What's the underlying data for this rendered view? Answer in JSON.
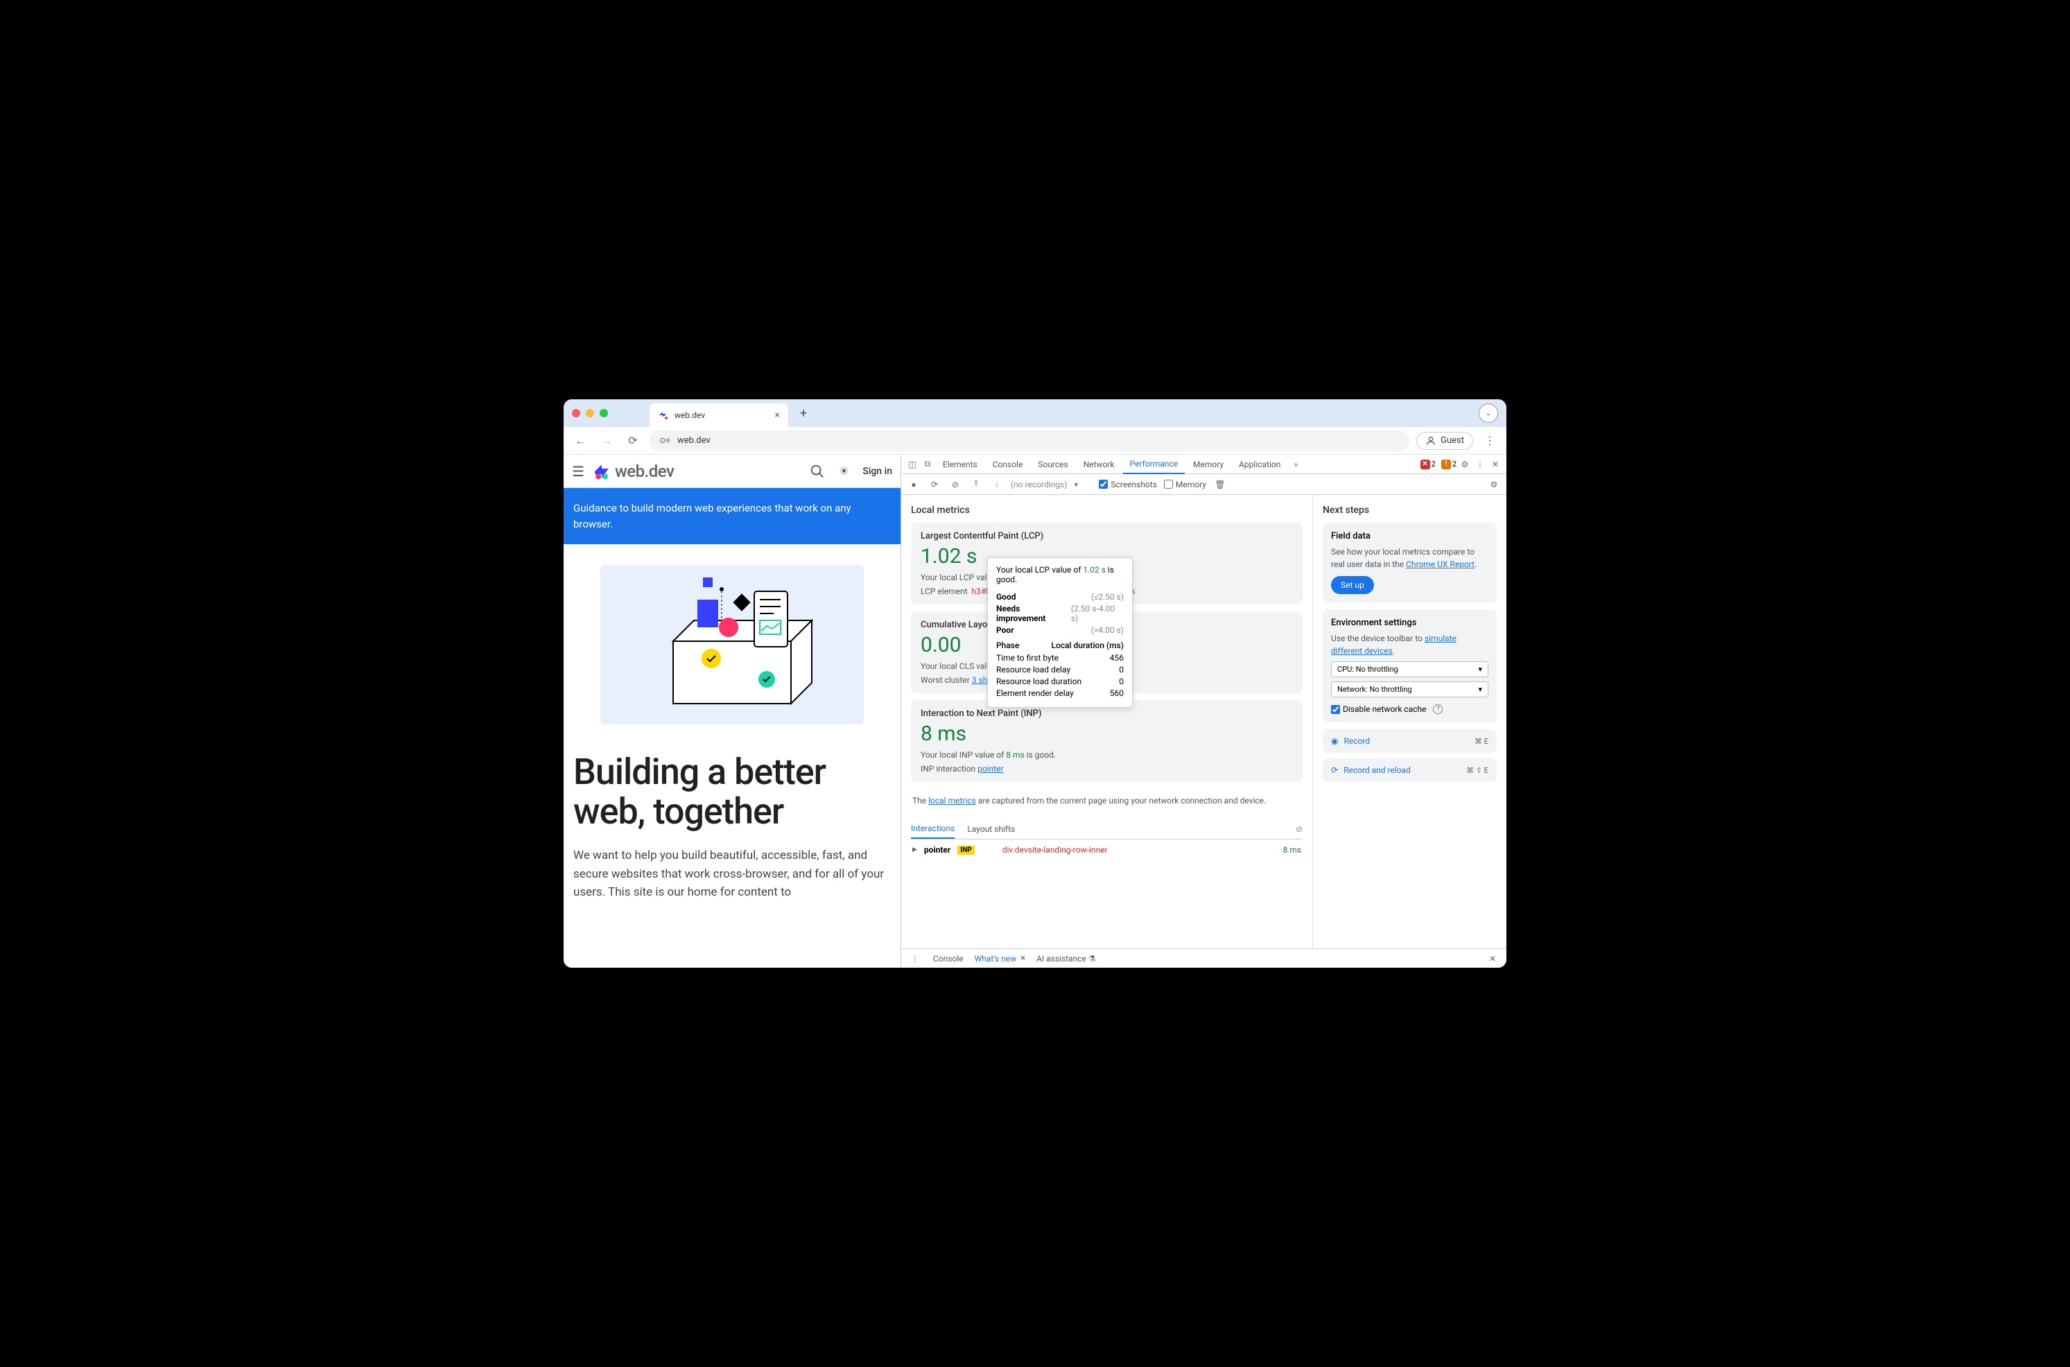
{
  "browser": {
    "tab_title": "web.dev",
    "url": "web.dev",
    "guest": "Guest"
  },
  "page": {
    "logo_text": "web.dev",
    "signin": "Sign in",
    "banner": "Guidance to build modern web experiences that work on any browser.",
    "hero_title": "Building a better web, together",
    "hero_sub": "We want to help you build beautiful, accessible, fast, and secure websites that work cross-browser, and for all of your users. This site is our home for content to"
  },
  "devtools": {
    "tabs": [
      "Elements",
      "Console",
      "Sources",
      "Network",
      "Performance",
      "Memory",
      "Application"
    ],
    "active_tab": "Performance",
    "errors": "2",
    "warnings": "2",
    "toolbar": {
      "no_recordings": "(no recordings)",
      "screenshots": "Screenshots",
      "memory": "Memory"
    },
    "local_metrics": "Local metrics",
    "lcp": {
      "title": "Largest Contentful Paint (LCP)",
      "value": "1.02 s",
      "desc_prefix": "Your local LCP valu",
      "element_label": "LCP element",
      "selector": "h3#b",
      "selector_ext": ".toc.no-link"
    },
    "cls": {
      "title": "Cumulative Layo",
      "value": "0.00",
      "desc": "Your local CLS valu",
      "worst_label": "Worst cluster",
      "worst_link": "3 shifts"
    },
    "inp": {
      "title": "Interaction to Next Paint (INP)",
      "value": "8 ms",
      "desc_prefix": "Your local INP value of ",
      "desc_val": "8 ms",
      "desc_suffix": " is good.",
      "int_label": "INP interaction",
      "int_link": "pointer"
    },
    "note_prefix": "The ",
    "note_link": "local metrics",
    "note_suffix": " are captured from the current page using your network connection and device.",
    "sub_tabs": {
      "interactions": "Interactions",
      "layout": "Layout shifts"
    },
    "interaction_row": {
      "type": "pointer",
      "badge": "INP",
      "selector": "div.devsite-landing-row-inner",
      "time": "8 ms"
    },
    "tooltip": {
      "line1_pre": "Your local LCP value of ",
      "line1_val": "1.02 s",
      "line1_post": " is good.",
      "good": "Good",
      "good_r": "(≤2.50 s)",
      "needs": "Needs improvement",
      "needs_r": "(2.50 s-4.00 s)",
      "poor": "Poor",
      "poor_r": "(>4.00 s)",
      "phase": "Phase",
      "duration": "Local duration (ms)",
      "rows": [
        [
          "Time to first byte",
          "456"
        ],
        [
          "Resource load delay",
          "0"
        ],
        [
          "Resource load duration",
          "0"
        ],
        [
          "Element render delay",
          "560"
        ]
      ]
    }
  },
  "next": {
    "title": "Next steps",
    "field": {
      "title": "Field data",
      "desc_pre": "See how your local metrics compare to real user data in the ",
      "link": "Chrome UX Report",
      "button": "Set up"
    },
    "env": {
      "title": "Environment settings",
      "desc_pre": "Use the device toolbar to ",
      "link": "simulate different devices",
      "cpu": "CPU: No throttling",
      "net": "Network: No throttling",
      "cache": "Disable network cache"
    },
    "record": {
      "label": "Record",
      "kb": "⌘ E"
    },
    "reload": {
      "label": "Record and reload",
      "kb": "⌘ ⇧ E"
    }
  },
  "footer": {
    "console": "Console",
    "whatsnew": "What's new",
    "ai": "AI assistance"
  }
}
